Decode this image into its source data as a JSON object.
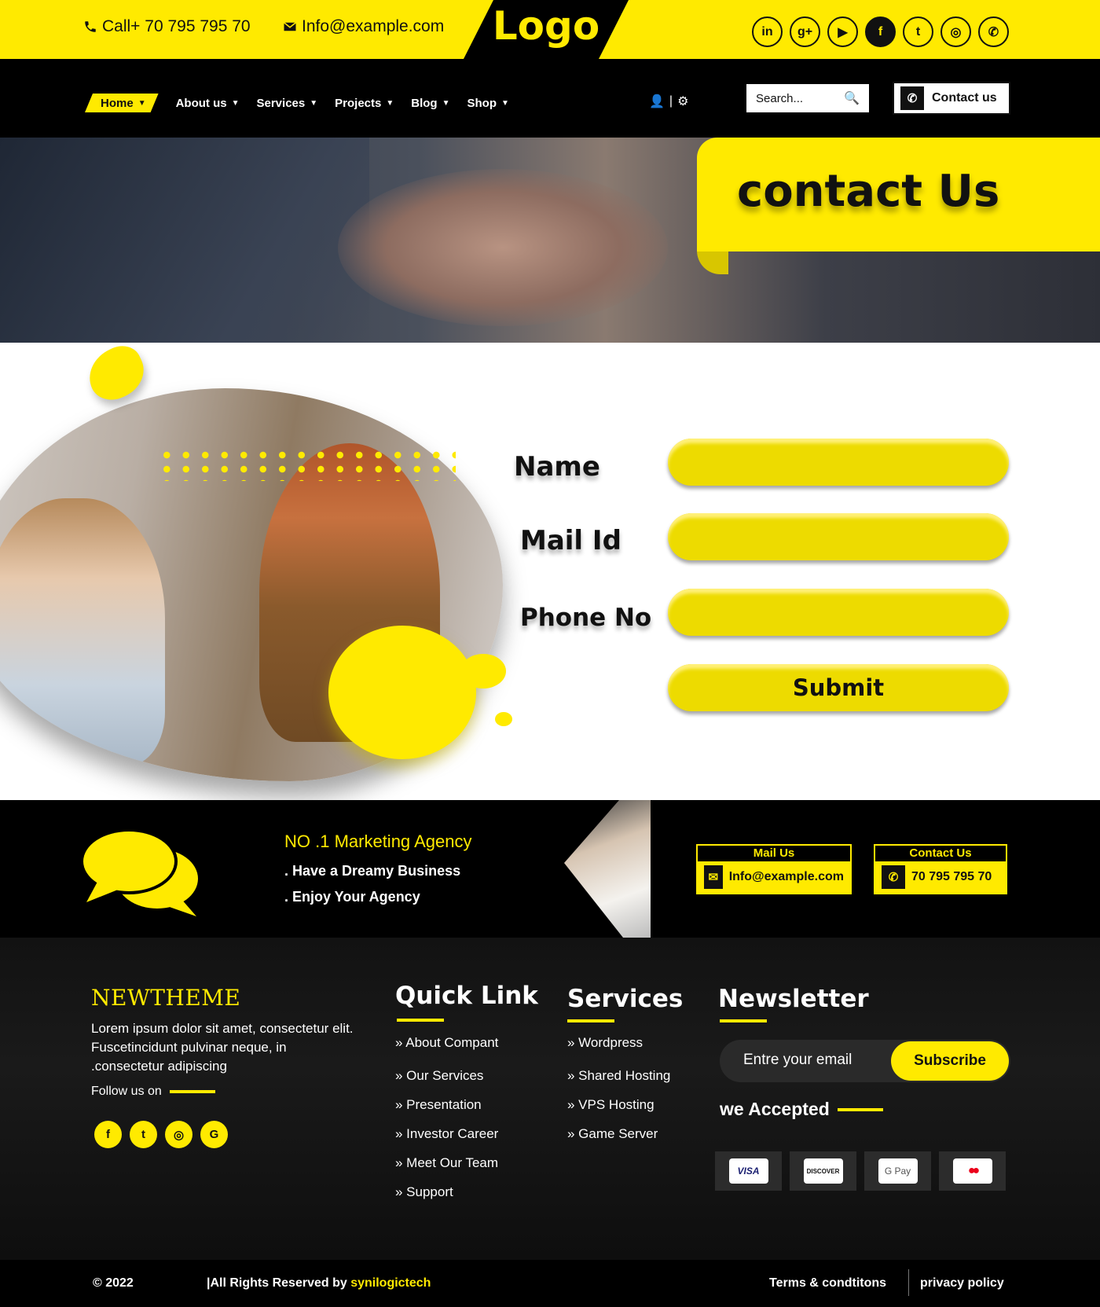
{
  "topbar": {
    "phone": "Call+ 70 795 795 70",
    "email": "Info@example.com",
    "logo": "Logo",
    "socials": [
      {
        "icon": "linkedin-icon",
        "glyph": "in"
      },
      {
        "icon": "google-plus-icon",
        "glyph": "g+"
      },
      {
        "icon": "youtube-icon",
        "glyph": "▶"
      },
      {
        "icon": "facebook-icon",
        "glyph": "f"
      },
      {
        "icon": "twitter-icon",
        "glyph": "t"
      },
      {
        "icon": "instagram-icon",
        "glyph": "◎"
      },
      {
        "icon": "whatsapp-icon",
        "glyph": "✆"
      }
    ]
  },
  "nav": {
    "items": [
      {
        "label": "Home",
        "active": true
      },
      {
        "label": "About us"
      },
      {
        "label": "Services"
      },
      {
        "label": "Projects"
      },
      {
        "label": "Blog"
      },
      {
        "label": "Shop"
      }
    ],
    "search_placeholder": "Search...",
    "contact_button": "Contact us"
  },
  "hero": {
    "title": "contact Us"
  },
  "form": {
    "name_label": "Name",
    "mail_label": "Mail Id",
    "phone_label": "Phone No",
    "submit_label": "Submit"
  },
  "banner": {
    "title": "NO .1 Marketing Agency",
    "line1": ". Have a Dreamy Business",
    "line2": ". Enjoy Your Agency",
    "mail_head": "Mail Us",
    "mail_value": "Info@example.com",
    "contact_head": "Contact Us",
    "contact_value": "70 795 795 70"
  },
  "footer": {
    "brand": "NEWTHEME",
    "description": "Lorem ipsum dolor sit amet, consectetur elit. Fuscetincidunt pulvinar neque, in .consectetur adipiscing",
    "follow": "Follow us on",
    "quick_title": "Quick Link",
    "quick_links": [
      "» About Compant",
      "» Our Services",
      "» Presentation",
      "» Investor Career",
      "» Meet Our Team",
      "» Support"
    ],
    "services_title": "Services",
    "services_links": [
      "» Wordpress",
      "» Shared Hosting",
      "» VPS Hosting",
      "» Game Server"
    ],
    "newsletter_title": "Newsletter",
    "newsletter_placeholder": "Entre your email",
    "subscribe": "Subscribe",
    "accepted": "we Accepted",
    "payments": [
      "VISA",
      "DISCOVER",
      "G Pay",
      "●●"
    ]
  },
  "bottom": {
    "copyright": "© 2022",
    "rights_prefix": "|All Rights Reserved by ",
    "rights_brand": "synilogictech",
    "terms": "Terms & condtitons",
    "privacy": "privacy policy"
  },
  "colors": {
    "accent": "#ffea00",
    "dark": "#000000"
  }
}
